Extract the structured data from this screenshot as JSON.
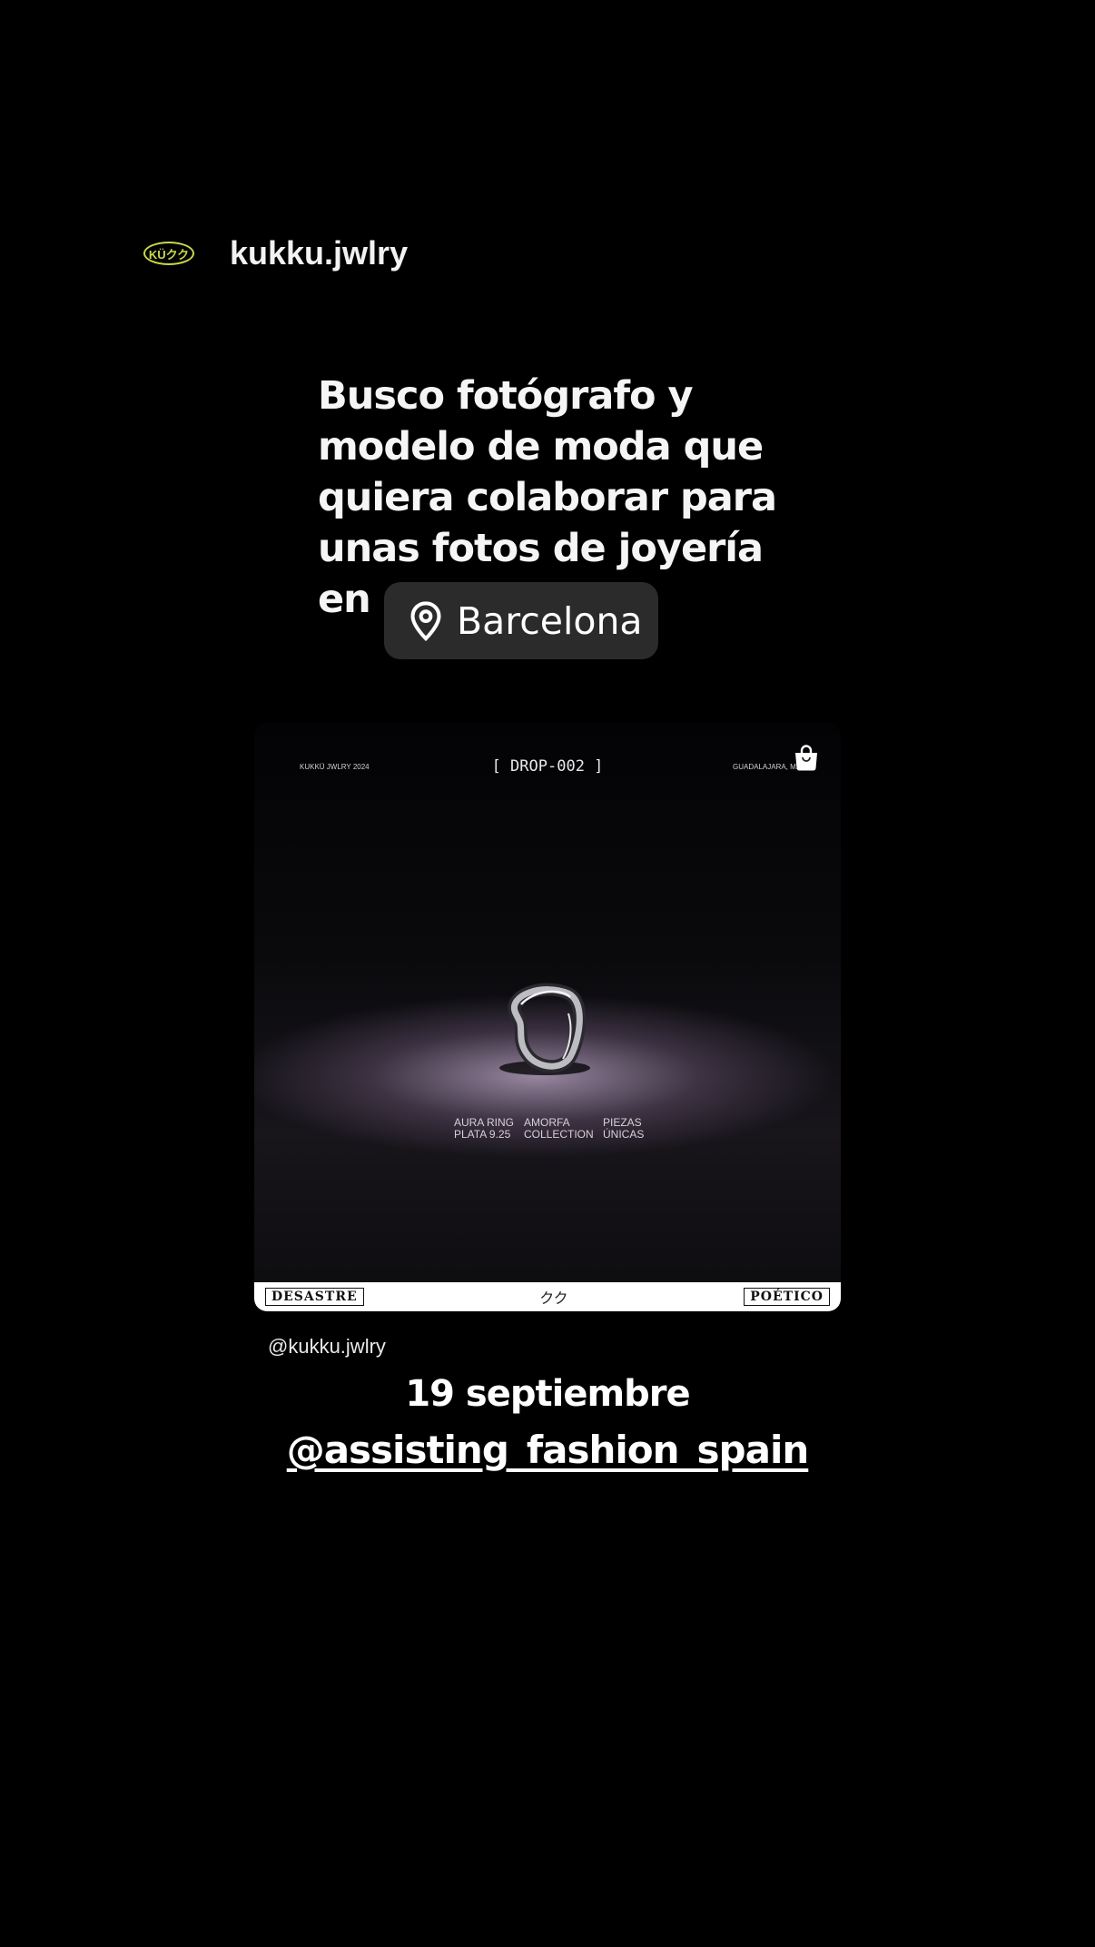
{
  "header": {
    "avatar_text": "KÜクク",
    "username": "kukku.jwlry"
  },
  "story": {
    "text_lines": [
      "Busco fotógrafo y",
      "modelo de moda que",
      "quiera colaborar para",
      "unas fotos de joyería",
      "en"
    ],
    "location": "Barcelona"
  },
  "post": {
    "top_left": "KUKKÜ JWLRY 2024",
    "top_center": "[ DROP-002 ]",
    "top_right": "GUADALAJARA, MX",
    "captions": [
      {
        "line1": "AURA RING",
        "line2": "PLATA 9.25"
      },
      {
        "line1": "AMORFA",
        "line2": "COLLECTION"
      },
      {
        "line1": "PIEZAS",
        "line2": "ÚNICAS"
      }
    ],
    "bottom_left": "DESASTRE",
    "bottom_center": "クク",
    "bottom_right": "POÉTICO",
    "handle": "@kukku.jwlry"
  },
  "footer": {
    "date": "19 septiembre",
    "mention": "@assisting_fashion_spain"
  },
  "colors": {
    "background": "#000000",
    "avatar_accent": "#c9d84a",
    "location_chip": "#2b2b2b",
    "spotlight": "#c4aece"
  }
}
